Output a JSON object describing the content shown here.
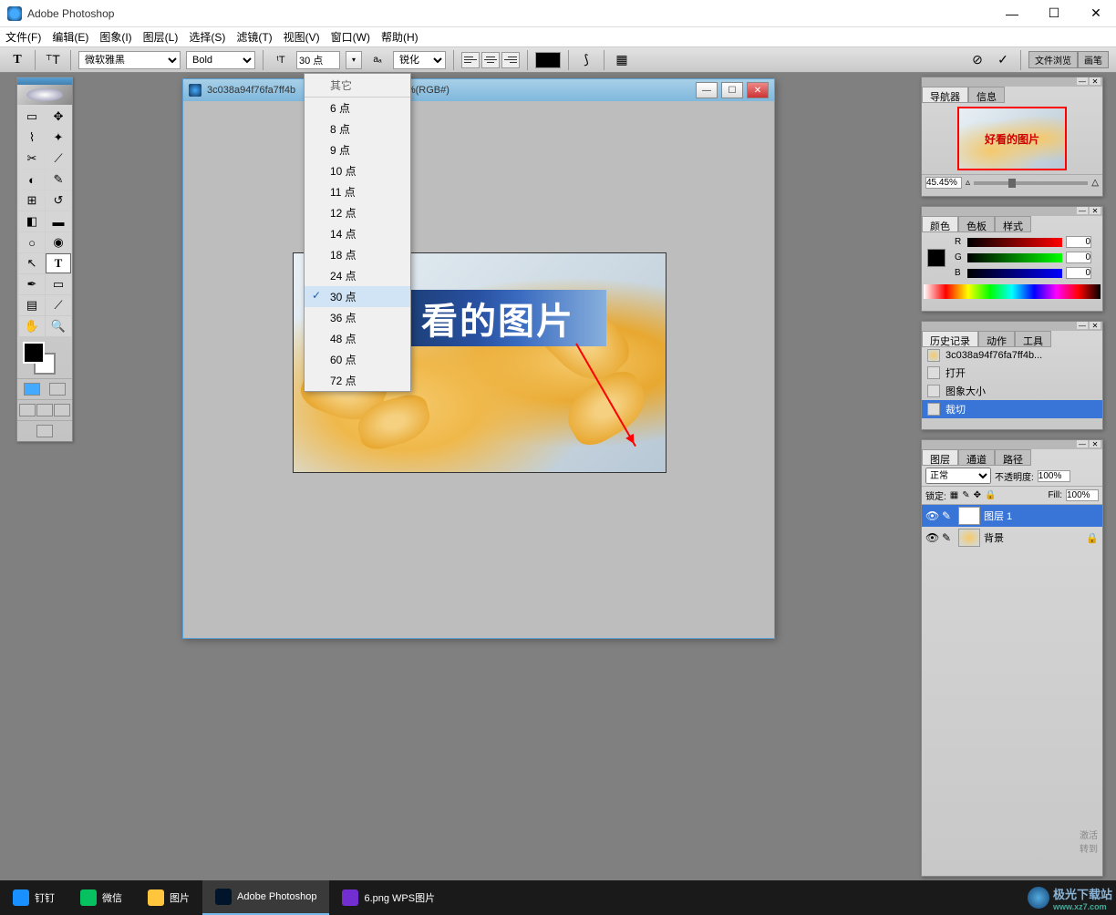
{
  "titlebar": {
    "app_name": "Adobe Photoshop"
  },
  "menu": {
    "file": "文件(F)",
    "edit": "编辑(E)",
    "image": "图象(I)",
    "layer": "图层(L)",
    "select": "选择(S)",
    "filter": "滤镜(T)",
    "view": "视图(V)",
    "window": "窗口(W)",
    "help": "帮助(H)"
  },
  "options": {
    "font_family": "微软雅黑",
    "font_weight": "Bold",
    "font_size": "30 点",
    "aa_label": "锐化",
    "size_dropdown_header": "其它"
  },
  "size_options": [
    "6 点",
    "8 点",
    "9 点",
    "10 点",
    "11 点",
    "12 点",
    "14 点",
    "18 点",
    "24 点",
    "30 点",
    "36 点",
    "48 点",
    "60 点",
    "72 点"
  ],
  "size_selected": "30 点",
  "palette_tabs": {
    "file_browse": "文件浏览",
    "brush": "画笔"
  },
  "document": {
    "title_prefix": "3c038a94f76fa7ff4b",
    "title_suffix": "g @ 45.5%(RGB#)",
    "text_overlay": "看的图片"
  },
  "navigator": {
    "tabs": [
      "导航器",
      "信息"
    ],
    "thumb_text": "好看的图片",
    "zoom": "45.45%"
  },
  "color": {
    "tabs": [
      "颜色",
      "色板",
      "样式"
    ],
    "r_label": "R",
    "g_label": "G",
    "b_label": "B",
    "r": "0",
    "g": "0",
    "b": "0"
  },
  "history": {
    "tabs": [
      "历史记录",
      "动作",
      "工具"
    ],
    "file_label": "3c038a94f76fa7ff4b...",
    "items": [
      {
        "label": "打开",
        "sel": false
      },
      {
        "label": "图象大小",
        "sel": false
      },
      {
        "label": "裁切",
        "sel": true
      }
    ]
  },
  "layers": {
    "tabs": [
      "图层",
      "通道",
      "路径"
    ],
    "blend_mode": "正常",
    "opacity_label": "不透明度:",
    "opacity": "100%",
    "lock_label": "锁定:",
    "fill_label": "Fill:",
    "fill": "100%",
    "items": [
      {
        "name": "图层 1",
        "type": "T",
        "sel": true
      },
      {
        "name": "背景",
        "type": "img",
        "sel": false
      }
    ]
  },
  "watermark": {
    "line1": "激活",
    "line2": "转到"
  },
  "taskbar": {
    "items": [
      {
        "label": "钉钉",
        "color": "#1890ff"
      },
      {
        "label": "微信",
        "color": "#07c160"
      },
      {
        "label": "图片",
        "color": "#ffc53d"
      },
      {
        "label": "Adobe Photoshop",
        "color": "#001529",
        "active": true
      },
      {
        "label": "6.png  WPS图片",
        "color": "#722ed1"
      }
    ]
  },
  "brand": {
    "name": "极光下载站",
    "url": "www.xz7.com"
  }
}
